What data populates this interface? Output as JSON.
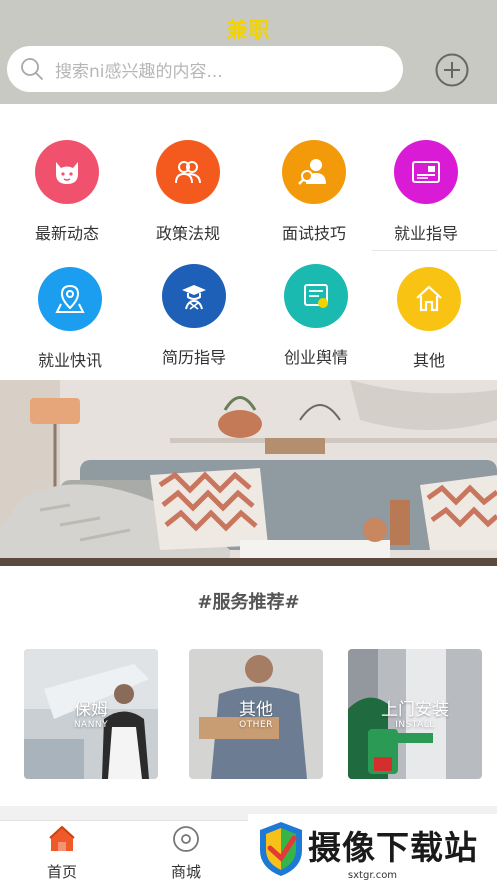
{
  "header": {
    "app_title": "兼职",
    "search_placeholder": "搜索ni感兴趣的内容..."
  },
  "categories": [
    {
      "label": "最新动态",
      "color": "#f0526d",
      "icon": "cat-face-icon"
    },
    {
      "label": "政策法规",
      "color": "#f45a1d",
      "icon": "people-icon"
    },
    {
      "label": "面试技巧",
      "color": "#f29a0a",
      "icon": "person-search-icon"
    },
    {
      "label": "就业指导",
      "color": "#d91bd6",
      "icon": "card-icon"
    },
    {
      "label": "就业快讯",
      "color": "#1b9ef0",
      "icon": "location-pin-icon"
    },
    {
      "label": "简历指导",
      "color": "#1e5fb8",
      "icon": "graduate-icon"
    },
    {
      "label": "创业舆情",
      "color": "#1bbab0",
      "icon": "document-icon"
    },
    {
      "label": "其他",
      "color": "#f8c312",
      "icon": "home-icon"
    }
  ],
  "services": {
    "title": "#服务推荐#",
    "items": [
      {
        "title": "保姆",
        "subtitle": "NANNY"
      },
      {
        "title": "其他",
        "subtitle": "OTHER"
      },
      {
        "title": "上门安装",
        "subtitle": "INSTALL"
      }
    ]
  },
  "tabs": [
    {
      "label": "首页",
      "active": true
    },
    {
      "label": "商城",
      "active": false
    }
  ],
  "watermark": {
    "title": "摄像下载站",
    "url": "sxtgr.com"
  },
  "colors": {
    "accent": "#f2d300",
    "header_bg": "#c9c9c4",
    "active_tab": "#f05a2b"
  }
}
